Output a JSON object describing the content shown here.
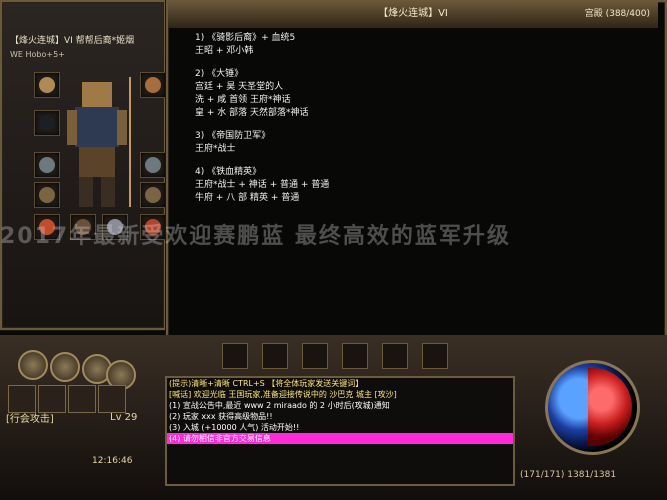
{
  "character_panel": {
    "title": "【烽火连城】VI 帮帮后裔*姬烟",
    "header_label": "WE Hobo+5+"
  },
  "stat_panel": {
    "title": "【烽火连城】VI",
    "top_right": "宫殿 (388/400)"
  },
  "lines": [
    "1) 《骑影后裔》+ 血统5",
    "    王昭 + 邓小韩",
    "2) 《大锤》",
    "    宫廷 + 昊 天圣堂的人",
    "    洗 + 咸 首领 王府*神话",
    "    皇 + 水 部落 天然部落*神话",
    "3) 《帝国防卫军》",
    "    王府*战士",
    "4) 《铁血精英》",
    "    王府*战士 + 神话 + 普通 + 普通",
    "    牛府 + 八 部 精英 + 普通"
  ],
  "overlay_text": "2017年最新受欢迎赛鹏蓝 最终高效的蓝军升级",
  "chat": {
    "lines": [
      "(提示)清晰+清晰 CTRL+S 【将全体玩家发送关键词】",
      "[喊话] 欢迎光临 王国玩家,准备迎接传说中的 沙巴克 城主 [攻沙]",
      "(1) 宣战公告中,最近 www 2 miraado 的 2 小时后(攻城)通知",
      "(2) 玩家 xxx 获得高级物品!!",
      "(3) 入城 (+10000 人气) 活动开始!!",
      "(4) 请勿相信非官方交易信息"
    ]
  },
  "status": {
    "coords": "(171/171) 1381/1381",
    "time": "12:16:46"
  },
  "left_labels": {
    "level": "Lv 29",
    "mode": "[行会攻击]"
  },
  "colors": {
    "accent": "#6b5a3a",
    "chat_bg": "#0e0d0b",
    "highlight_magenta": "#ff2bd8",
    "highlight_yellow": "#ffe86a"
  }
}
